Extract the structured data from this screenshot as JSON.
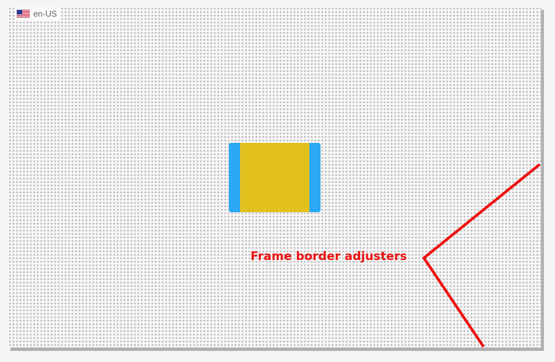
{
  "locale": {
    "flag_icon": "us-flag-icon",
    "code": "en-US"
  },
  "frame_widget": {
    "border_color": "#2aa8f5",
    "body_color": "#e2c11e"
  },
  "annotation": {
    "label": "Frame border adjusters",
    "color": "#ee1111"
  }
}
